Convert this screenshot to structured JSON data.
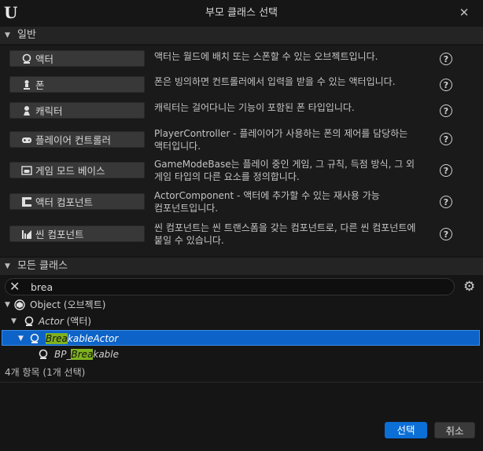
{
  "window": {
    "title": "부모 클래스 선택",
    "logo_glyph": "U",
    "close_glyph": "✕"
  },
  "sections": {
    "general": "일반",
    "all_classes": "모든 클래스"
  },
  "common_classes": [
    {
      "label": "액터",
      "icon": "actor-sphere-icon",
      "desc": [
        "액터는 월드에 배치 또는 스폰할 수 있는 오브젝트입니다."
      ]
    },
    {
      "label": "폰",
      "icon": "pawn-icon",
      "desc": [
        "폰은 빙의하면 컨트롤러에서 입력을 받을 수 있는 액터입니다."
      ]
    },
    {
      "label": "캐릭터",
      "icon": "character-icon",
      "desc": [
        "캐릭터는 걸어다니는 기능이 포함된 폰 타입입니다."
      ]
    },
    {
      "label": "플레이어 컨트롤러",
      "icon": "gamepad-icon",
      "desc": [
        "PlayerController - 플레이어가 사용하는 폰의 제어를 담당하는",
        "액터입니다."
      ]
    },
    {
      "label": "게임 모드 베이스",
      "icon": "game-mode-icon",
      "desc": [
        "GameModeBase는 플레이 중인 게임, 그 규칙, 득점 방식, 그 외",
        "게임 타입의 다른 요소를 정의합니다."
      ]
    },
    {
      "label": "액터 컴포넌트",
      "icon": "component-icon",
      "desc": [
        "ActorComponent - 액터에 추가할 수 있는 재사용 가능",
        "컴포넌트입니다."
      ]
    },
    {
      "label": "씬 컴포넌트",
      "icon": "scene-component-icon",
      "desc": [
        "씬 컴포넌트는 씬 트랜스폼을 갖는 컴포넌트로, 다른 씬 컴포넌트에",
        "붙일 수 있습니다."
      ]
    }
  ],
  "help_glyph": "?",
  "search": {
    "value": "brea",
    "clear_glyph": "✕",
    "settings_glyph": "⚙"
  },
  "tree": {
    "object_label": "Object (오브젝트)",
    "actor_label": "Actor",
    "actor_suffix": "(액터)",
    "breakable_match": "Brea",
    "breakable_rest": "kableActor",
    "bp_prefix": "BP_",
    "bp_match": "Brea",
    "bp_rest": "kable"
  },
  "status": {
    "count_text": "4개 항목 (1개 선택)"
  },
  "footer": {
    "select_label": "선택",
    "cancel_label": "취소"
  },
  "colors": {
    "selection": "#0d63c7",
    "highlight": "#7fb21f",
    "primary_button": "#0b6fd6"
  }
}
